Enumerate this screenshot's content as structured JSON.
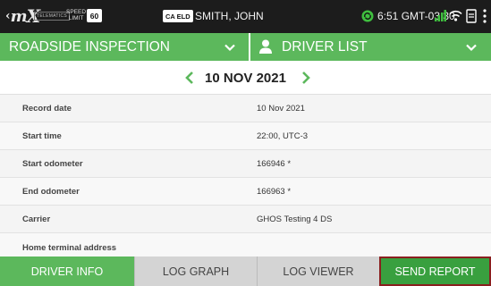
{
  "status_bar": {
    "telematics_label": "TELEMATICS",
    "speed_label_line1": "SPEED",
    "speed_label_line2": "LIMIT",
    "speed_limit": "60",
    "eld_badge": "CA ELD",
    "driver_name": "SMITH, JOHN",
    "time": "6:51 GMT-03:30"
  },
  "header": {
    "left_title": "ROADSIDE INSPECTION",
    "right_title": "DRIVER LIST"
  },
  "date_nav": {
    "date": "10 NOV 2021"
  },
  "details": [
    {
      "label": "Record date",
      "value": "10 Nov 2021"
    },
    {
      "label": "Start time",
      "value": "22:00, UTC-3"
    },
    {
      "label": "Start odometer",
      "value": "166946 *"
    },
    {
      "label": "End odometer",
      "value": "166963 *"
    },
    {
      "label": "Carrier",
      "value": "GHOS Testing 4 DS"
    },
    {
      "label": "Home terminal address",
      "value": ""
    }
  ],
  "tabs": [
    {
      "label": "DRIVER INFO"
    },
    {
      "label": "LOG GRAPH"
    },
    {
      "label": "LOG VIEWER"
    },
    {
      "label": "SEND REPORT"
    }
  ],
  "colors": {
    "accent_green": "#5cb85c",
    "send_report_border": "#8a1f1f",
    "status_bar_bg": "#1c1c1c"
  },
  "icons": [
    "logo",
    "sync-icon",
    "signal-icon",
    "wifi-icon",
    "tablet-icon",
    "menu-dots-icon",
    "chevron-down-icon",
    "person-icon",
    "chevron-left-icon",
    "chevron-right-icon"
  ]
}
